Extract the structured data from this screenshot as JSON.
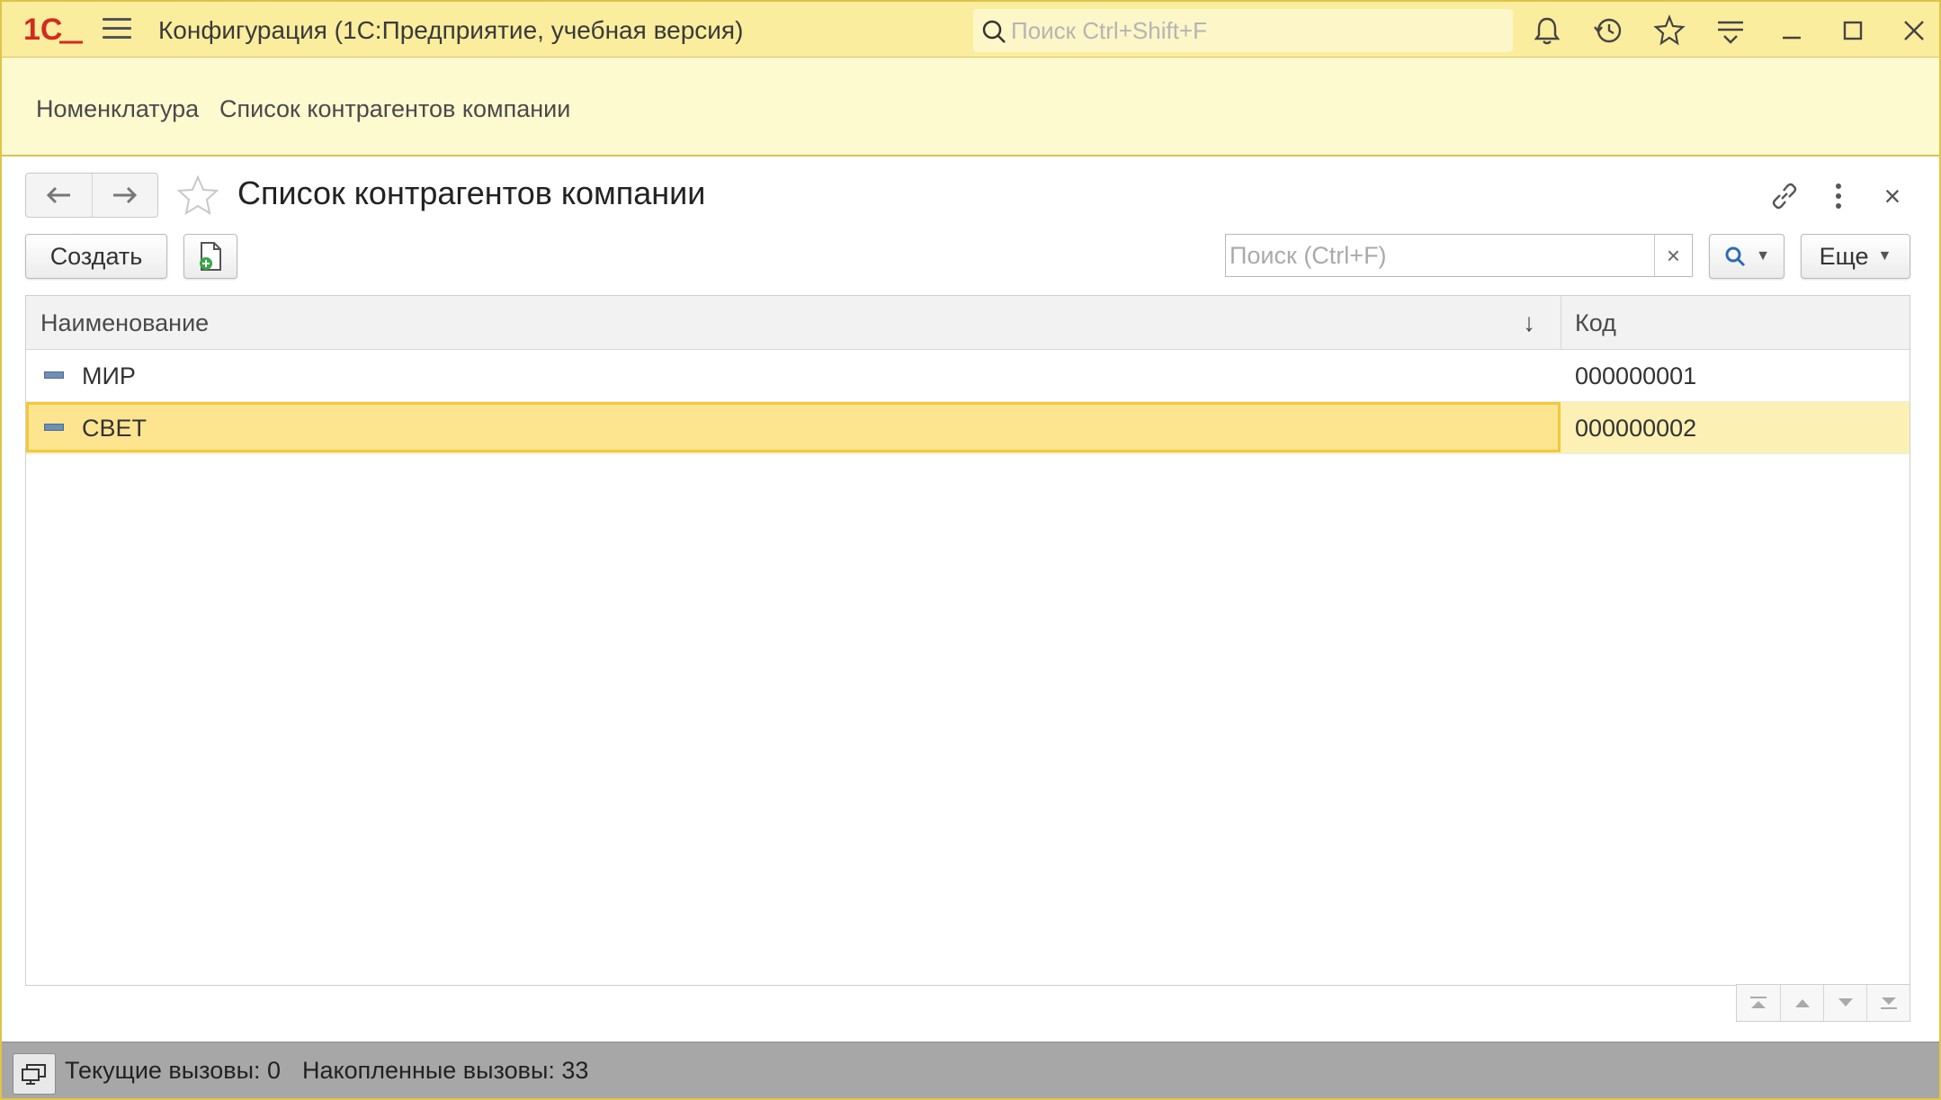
{
  "window": {
    "app_title": "Конфигурация  (1С:Предприятие, учебная версия)",
    "global_search_placeholder": "Поиск Ctrl+Shift+F",
    "logo": "1С"
  },
  "sections": [
    {
      "label": "Номенклатура"
    },
    {
      "label": "Список контрагентов компании"
    }
  ],
  "form": {
    "title": "Список контрагентов компании",
    "create_label": "Создать",
    "search_placeholder": "Поиск (Ctrl+F)",
    "clear_label": "×",
    "more_label": "Еще",
    "close_label": "×"
  },
  "table": {
    "columns": [
      {
        "label": "Наименование",
        "sort": "↓"
      },
      {
        "label": "Код"
      }
    ],
    "rows": [
      {
        "name": "МИР",
        "code": "000000001",
        "selected": false
      },
      {
        "name": "СВЕТ",
        "code": "000000002",
        "selected": true
      }
    ]
  },
  "status": {
    "current_calls": "Текущие вызовы: 0",
    "accumulated_calls": "Накопленные вызовы: 33"
  },
  "colors": {
    "titlebar": "#fbed9e",
    "section_strip": "#fdfad0",
    "selected_row": "#fde590",
    "selected_border": "#f4c838",
    "logo_red": "#d42a1e",
    "statusbar": "#a7a7a7"
  },
  "icons": [
    "logo-1c-icon",
    "menu-icon",
    "search-icon",
    "bell-icon",
    "history-icon",
    "star-icon",
    "panel-settings-icon",
    "minimize-icon",
    "maximize-icon",
    "close-icon",
    "back-arrow-icon",
    "forward-arrow-icon",
    "link-icon",
    "more-vertical-icon",
    "add-document-icon",
    "search-magnifier-icon",
    "chevron-down-icon",
    "scroll-top-icon",
    "scroll-up-icon",
    "scroll-down-icon",
    "scroll-bottom-icon",
    "monitor-icon"
  ]
}
